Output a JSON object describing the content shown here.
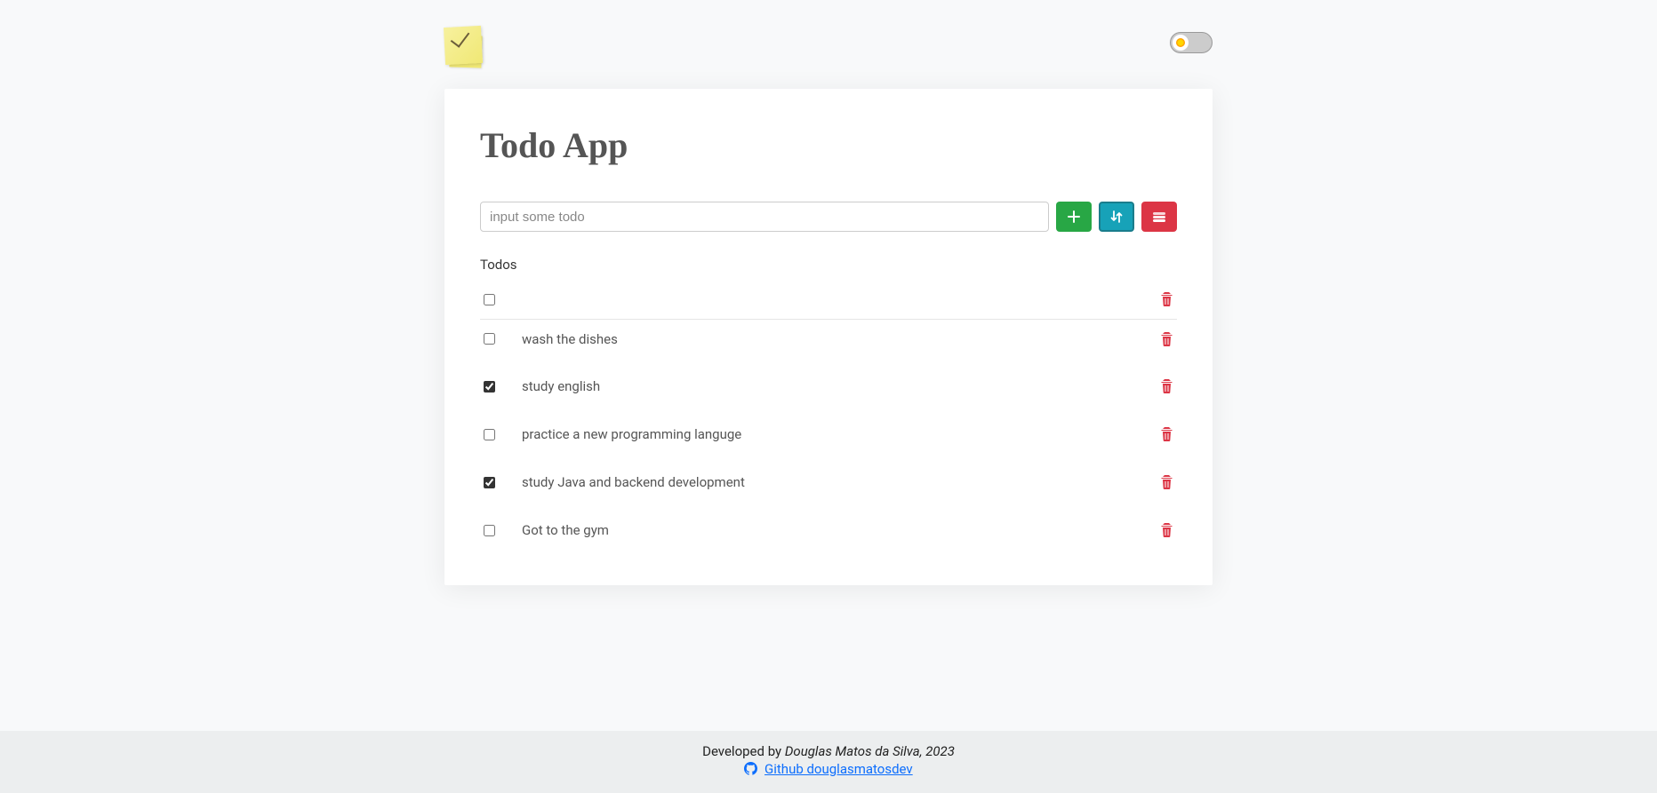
{
  "header": {
    "title": "Todo App"
  },
  "input": {
    "placeholder": "input some todo",
    "value": ""
  },
  "buttons": {
    "add_color": "#28a745",
    "sort_color": "#17a2b8",
    "clear_color": "#dc3545"
  },
  "section_label": "Todos",
  "todos": [
    {
      "text": "",
      "done": false
    },
    {
      "text": "wash the dishes",
      "done": false
    },
    {
      "text": "study english",
      "done": true
    },
    {
      "text": "practice a new programming languge",
      "done": false
    },
    {
      "text": "study Java and backend development",
      "done": true
    },
    {
      "text": "Got to the gym",
      "done": false
    }
  ],
  "footer": {
    "developed_by": "Developed by ",
    "author": "Douglas Matos da Silva, 2023",
    "github_label": "Github douglasmatosdev"
  },
  "theme": {
    "dark": false
  }
}
